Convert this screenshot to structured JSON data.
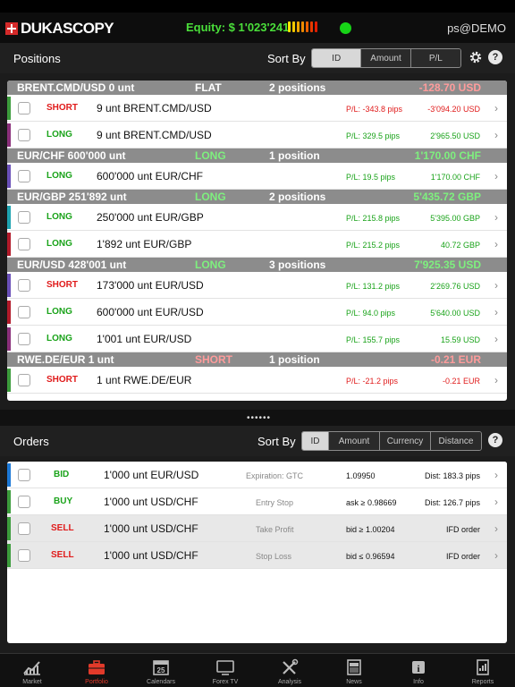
{
  "header": {
    "brand": "DUKASCOPY",
    "equity": "Equity: $ 1'023'241",
    "user": "ps@DEMO",
    "equity_color": "#4ade3a",
    "status_color": "#17d317"
  },
  "positions": {
    "title": "Positions",
    "sort_label": "Sort By",
    "sort_options": [
      "ID",
      "Amount",
      "P/L"
    ],
    "active_sort": "ID",
    "groups": [
      {
        "label": "BRENT.CMD/USD 0 unt",
        "direction": "FLAT",
        "count": "2 positions",
        "total": "-128.70 USD",
        "rows": [
          {
            "side": "SHORT",
            "instrument": "9 unt BRENT.CMD/USD",
            "pl": "P/L: -343.8 pips",
            "value": "-3'094.20 USD"
          },
          {
            "side": "LONG",
            "instrument": "9 unt BRENT.CMD/USD",
            "pl": "P/L: 329.5 pips",
            "value": "2'965.50 USD"
          }
        ]
      },
      {
        "label": "EUR/CHF 600'000 unt",
        "direction": "LONG",
        "count": "1 position",
        "total": "1'170.00 CHF",
        "rows": [
          {
            "side": "LONG",
            "instrument": "600'000 unt EUR/CHF",
            "pl": "P/L: 19.5 pips",
            "value": "1'170.00 CHF"
          }
        ]
      },
      {
        "label": "EUR/GBP 251'892 unt",
        "direction": "LONG",
        "count": "2 positions",
        "total": "5'435.72 GBP",
        "rows": [
          {
            "side": "LONG",
            "instrument": "250'000 unt EUR/GBP",
            "pl": "P/L: 215.8 pips",
            "value": "5'395.00 GBP"
          },
          {
            "side": "LONG",
            "instrument": "1'892 unt EUR/GBP",
            "pl": "P/L: 215.2 pips",
            "value": "40.72 GBP"
          }
        ]
      },
      {
        "label": "EUR/USD 428'001 unt",
        "direction": "LONG",
        "count": "3 positions",
        "total": "7'925.35 USD",
        "rows": [
          {
            "side": "SHORT",
            "instrument": "173'000 unt EUR/USD",
            "pl": "P/L: 131.2 pips",
            "value": "2'269.76 USD"
          },
          {
            "side": "LONG",
            "instrument": "600'000 unt EUR/USD",
            "pl": "P/L: 94.0 pips",
            "value": "5'640.00 USD"
          },
          {
            "side": "LONG",
            "instrument": "1'001 unt EUR/USD",
            "pl": "P/L: 155.7 pips",
            "value": "15.59 USD"
          }
        ]
      },
      {
        "label": "RWE.DE/EUR 1 unt",
        "direction": "SHORT",
        "count": "1 position",
        "total": "-0.21 EUR",
        "rows": [
          {
            "side": "SHORT",
            "instrument": "1 unt RWE.DE/EUR",
            "pl": "P/L: -21.2 pips",
            "value": "-0.21 EUR"
          }
        ]
      }
    ]
  },
  "orders": {
    "title": "Orders",
    "sort_label": "Sort By",
    "sort_options": [
      "ID",
      "Amount",
      "Currency",
      "Distance"
    ],
    "active_sort": "ID",
    "rows": [
      {
        "side": "BID",
        "instrument": "1'000 unt EUR/USD",
        "type": "Expiration: GTC",
        "price": "1.09950",
        "extra": "Dist: 183.3 pips"
      },
      {
        "side": "BUY",
        "instrument": "1'000 unt USD/CHF",
        "type": "Entry Stop",
        "price": "ask ≥ 0.98669",
        "extra": "Dist: 126.7 pips"
      },
      {
        "side": "SELL",
        "instrument": "1'000 unt USD/CHF",
        "type": "Take Profit",
        "price": "bid ≥ 1.00204",
        "extra": "IFD order"
      },
      {
        "side": "SELL",
        "instrument": "1'000 unt USD/CHF",
        "type": "Stop Loss",
        "price": "bid ≤ 0.96594",
        "extra": "IFD order"
      }
    ]
  },
  "tabs": [
    {
      "label": "Market",
      "icon": "chart-line-icon"
    },
    {
      "label": "Portfolio",
      "icon": "briefcase-icon"
    },
    {
      "label": "Calendars",
      "icon": "calendar-icon"
    },
    {
      "label": "Forex TV",
      "icon": "tv-icon"
    },
    {
      "label": "Analysis",
      "icon": "tools-icon"
    },
    {
      "label": "News",
      "icon": "newspaper-icon"
    },
    {
      "label": "Info",
      "icon": "info-icon"
    },
    {
      "label": "Reports",
      "icon": "report-icon"
    }
  ],
  "active_tab": "Portfolio",
  "colors": {
    "long": "#1aa31a",
    "short": "#e01b1b",
    "pl_green": "#1aa31a",
    "pl_red": "#e01b1b",
    "group_green": "#7ef07e",
    "group_red": "#ff9c9c",
    "active_tab": "#e23a2a"
  }
}
